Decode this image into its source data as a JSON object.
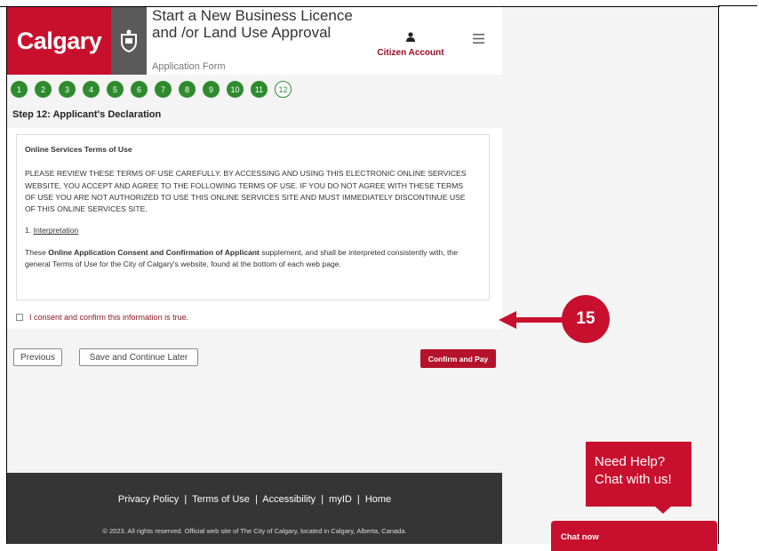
{
  "header": {
    "logo_text": "Calgary",
    "title": "Start a New Business Licence and /or Land Use Approval",
    "subtitle": "Application Form",
    "account_label": "Citizen Account"
  },
  "steps": [
    "1",
    "2",
    "3",
    "4",
    "5",
    "6",
    "7",
    "8",
    "9",
    "10",
    "11",
    "12"
  ],
  "current_step": "12",
  "step_title": "Step 12: Applicant's Declaration",
  "terms": {
    "title": "Online Services Terms of Use",
    "para1": "PLEASE REVIEW THESE TERMS OF USE CAREFULLY. BY ACCESSING AND USING THIS ELECTRONIC ONLINE SERVICES WEBSITE, YOU ACCEPT AND AGREE TO THE FOLLOWING TERMS OF USE. IF YOU DO NOT AGREE WITH THESE TERMS OF USE YOU ARE NOT AUTHORIZED TO USE THIS ONLINE SERVICES SITE AND MUST IMMEDIATELY DISCONTINUE USE OF THIS ONLINE SERVICES SITE.",
    "section_num": "1.",
    "section_title": "Interpretation",
    "para2_start": "These",
    "para2_bold": "Online Application Consent and Confirmation of Applicant",
    "para2_end": "supplement, and shall be interpreted consistently with, the general Terms of Use for the City of Calgary's website, found at the bottom of each web page."
  },
  "consent_label": "I consent and confirm this information is true.",
  "buttons": {
    "previous": "Previous",
    "save": "Save and Continue Later",
    "confirm": "Confirm and Pay"
  },
  "annotation": "15",
  "footer": {
    "links": [
      "Privacy Policy",
      "Terms of Use",
      "Accessibility",
      "myID",
      "Home"
    ],
    "copyright": "© 2023. All rights reserved. Official web site of The City of Calgary, located in Calgary, Alberta, Canada."
  },
  "help": {
    "line1": "Need Help?",
    "line2": "Chat with us!",
    "chat_label": "Chat now"
  },
  "colors": {
    "brand_red": "#c8102e",
    "step_green": "#2e8b2e"
  }
}
